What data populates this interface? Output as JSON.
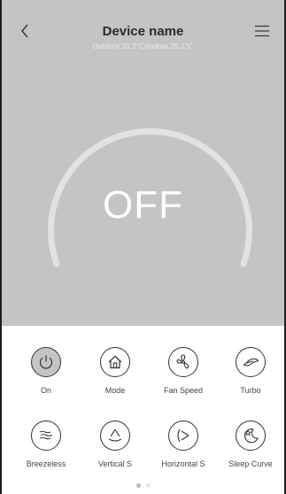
{
  "header": {
    "title": "Device name",
    "subtitle": "Outdoor 31.2℃/Indoor 25.1℃"
  },
  "dial": {
    "state": "OFF"
  },
  "controls": [
    {
      "label": "On",
      "icon": "power-icon",
      "active": true
    },
    {
      "label": "Mode",
      "icon": "home-icon"
    },
    {
      "label": "Fan Speed",
      "icon": "fan-icon"
    },
    {
      "label": "Turbo",
      "icon": "turbo-icon"
    },
    {
      "label": "Breezeless",
      "icon": "breeze-icon"
    },
    {
      "label": "Vertical S",
      "icon": "vertical-swing-icon"
    },
    {
      "label": "Horizontal S",
      "icon": "horizontal-swing-icon"
    },
    {
      "label": "Sleep Curve",
      "icon": "sleep-icon"
    }
  ],
  "pager": {
    "pages": 2,
    "current": 1
  },
  "colors": {
    "panel": "#c4c4c4",
    "active_button": "#c4c4c4"
  }
}
